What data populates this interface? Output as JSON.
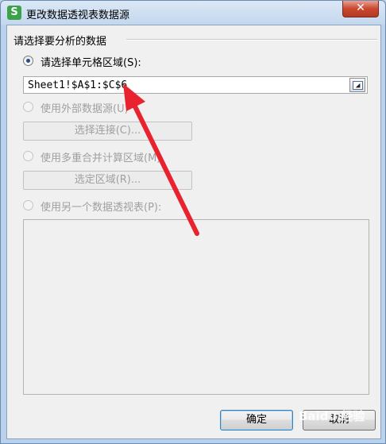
{
  "window": {
    "title": "更改数据透视表数据源",
    "close_glyph": "✕",
    "app_icon_letter": "S"
  },
  "group": {
    "label": "请选择要分析的数据"
  },
  "options": {
    "single_range": {
      "label": "请选择单元格区域(S):",
      "checked": true
    },
    "range_value": "Sheet1!$A$1:$C$6",
    "external": {
      "label": "使用外部数据源(U)",
      "checked": false
    },
    "select_connection_button": "选择连接(C)...",
    "multi_consolidation": {
      "label": "使用多重合并计算区域(M)",
      "checked": false
    },
    "select_region_button": "选定区域(R)...",
    "another_pivot": {
      "label": "使用另一个数据透视表(P):",
      "checked": false
    }
  },
  "buttons": {
    "ok": "确定",
    "cancel": "取消"
  },
  "annotation": {
    "arrow_color": "#e8222e"
  },
  "watermark": {
    "text": "Baidu 经验"
  }
}
